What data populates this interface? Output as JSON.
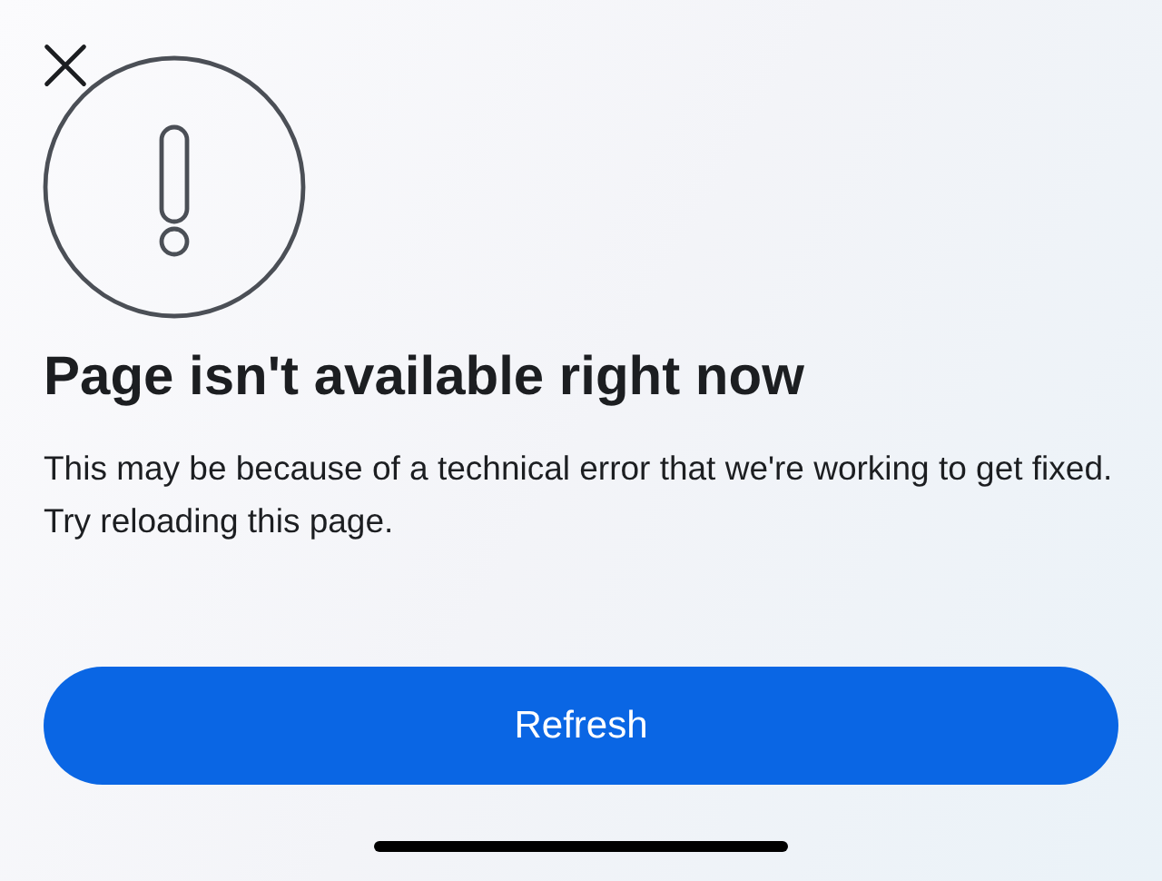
{
  "title": "Page isn't available right now",
  "message": "This may be because of a technical error that we're working to get fixed. Try reloading this page.",
  "button": {
    "label": "Refresh"
  }
}
